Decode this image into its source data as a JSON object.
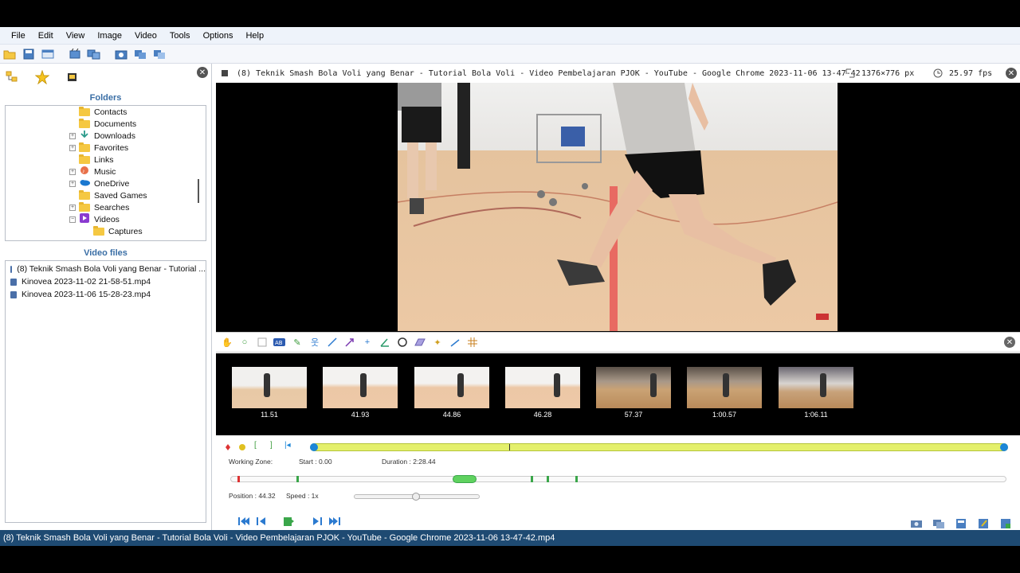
{
  "menu": [
    "File",
    "Edit",
    "View",
    "Image",
    "Video",
    "Tools",
    "Options",
    "Help"
  ],
  "left": {
    "folders_title": "Folders",
    "folders": [
      {
        "label": "Contacts",
        "exp": ""
      },
      {
        "label": "Documents",
        "exp": ""
      },
      {
        "label": "Downloads",
        "exp": "+"
      },
      {
        "label": "Favorites",
        "exp": "+"
      },
      {
        "label": "Links",
        "exp": ""
      },
      {
        "label": "Music",
        "exp": "+"
      },
      {
        "label": "OneDrive",
        "exp": "+"
      },
      {
        "label": "Saved Games",
        "exp": ""
      },
      {
        "label": "Searches",
        "exp": "+"
      },
      {
        "label": "Videos",
        "exp": "−"
      },
      {
        "label": "Captures",
        "exp": ""
      }
    ],
    "files_title": "Video files",
    "files": [
      "(8) Teknik Smash Bola Voli yang Benar - Tutorial ...",
      "Kinovea 2023-11-02 21-58-51.mp4",
      "Kinovea 2023-11-06 15-28-23.mp4"
    ]
  },
  "player": {
    "title": "(8) Teknik Smash Bola Voli yang Benar - Tutorial Bola Voli - Video Pembelajaran PJOK - YouTube - Google Chrome 2023-11-06 13-47-42",
    "dimensions": "1376×776 px",
    "fps": "25.97 fps",
    "thumbnails": [
      "11.51",
      "41.93",
      "44.86",
      "46.28",
      "57.37",
      "1:00.57",
      "1:06.11"
    ],
    "working_zone_label": "Working Zone:",
    "start_label": "Start : 0.00",
    "duration_label": "Duration : 2:28.44",
    "position_label": "Position : 44.32",
    "speed_label": "Speed : 1x"
  },
  "status": "(8) Teknik Smash Bola Voli yang Benar - Tutorial Bola Voli - Video Pembelajaran PJOK - YouTube - Google Chrome 2023-11-06 13-47-42.mp4",
  "colors": {
    "accent": "#1c86d8",
    "working_zone": "#e4f06c",
    "status_bar": "#1e4a72"
  }
}
